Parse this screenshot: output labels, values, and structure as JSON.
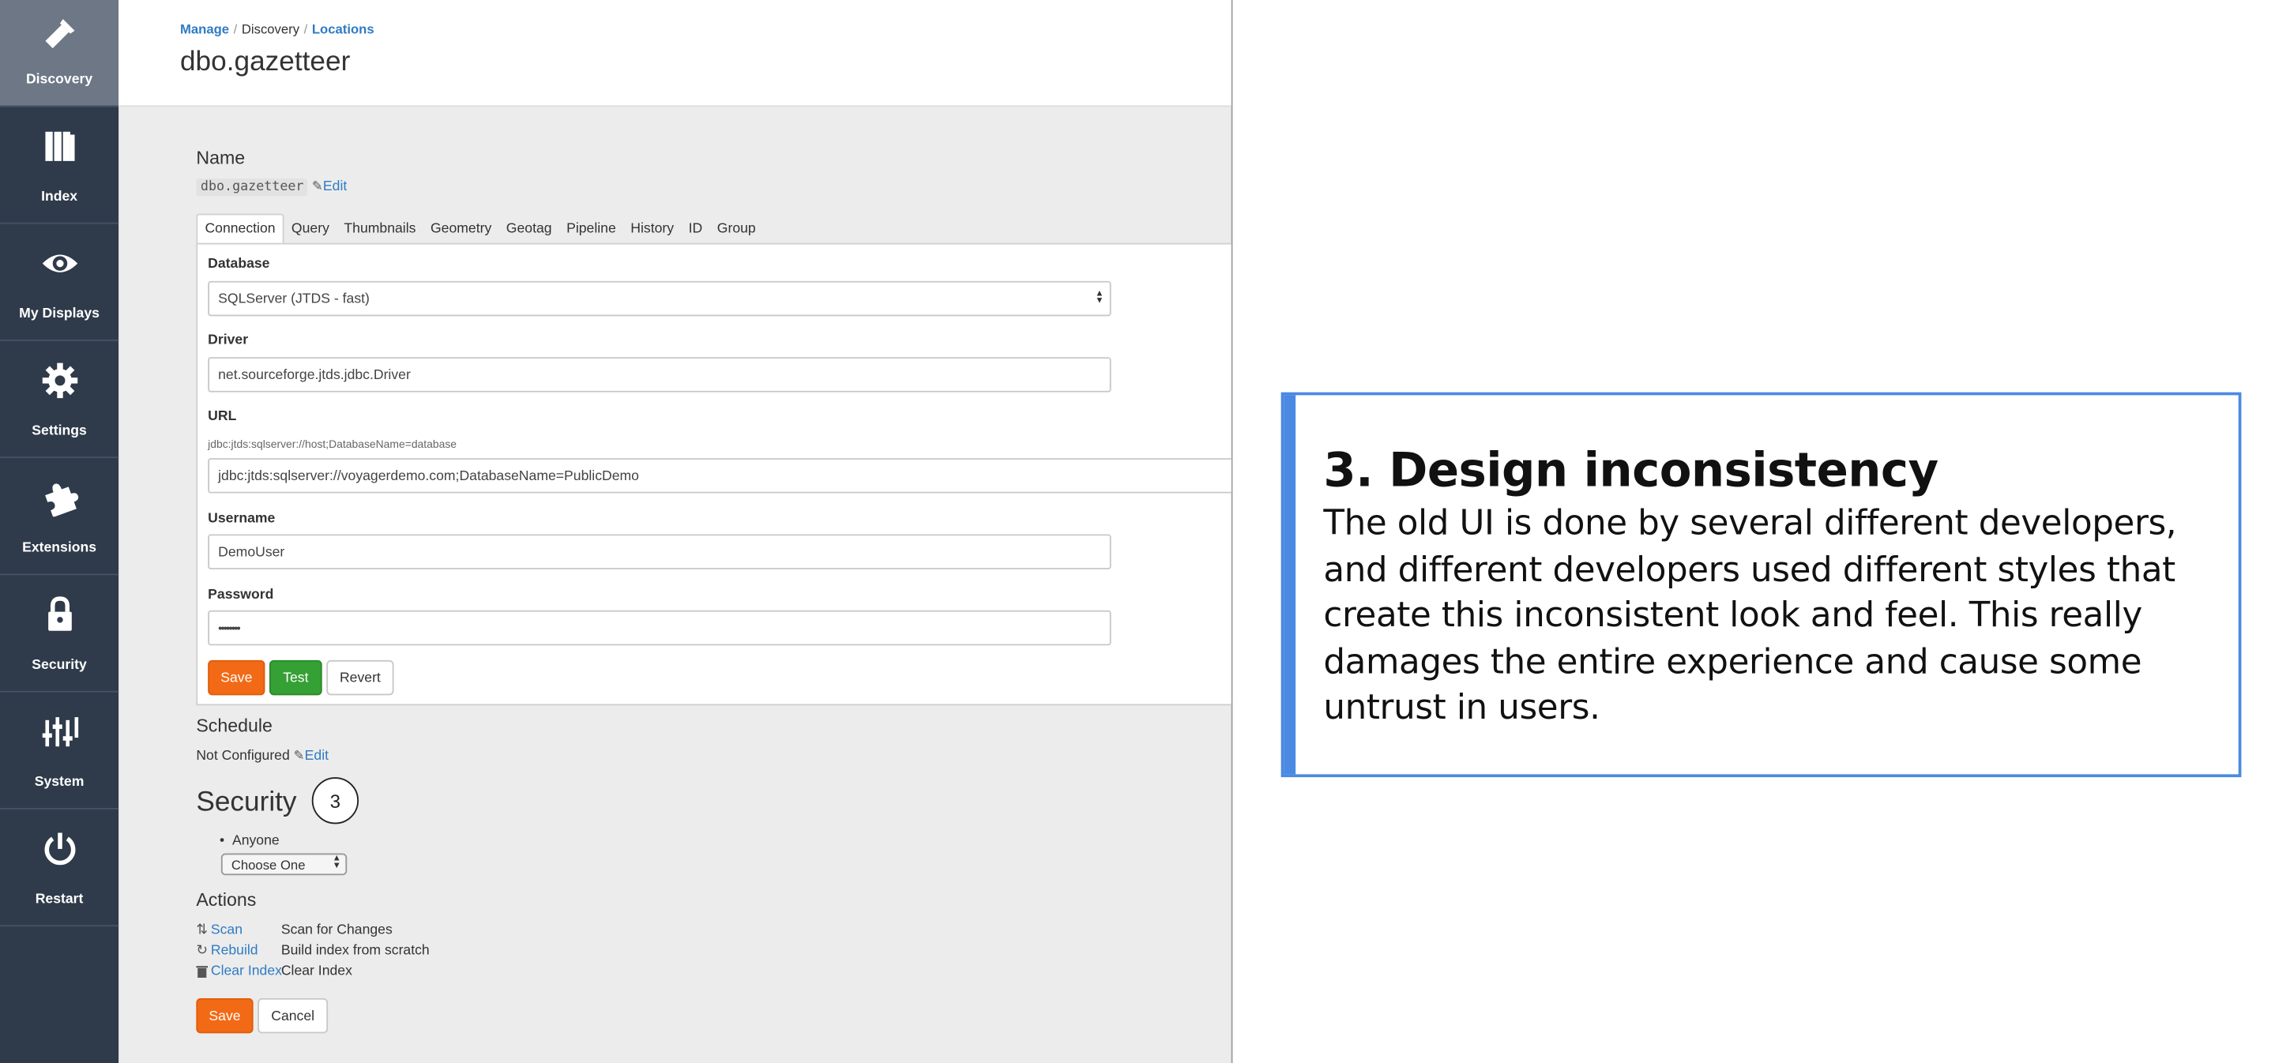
{
  "sidebar": {
    "items": [
      {
        "label": "Discovery",
        "icon": "flashlight-icon"
      },
      {
        "label": "Index",
        "icon": "books-icon"
      },
      {
        "label": "My Displays",
        "icon": "eye-icon"
      },
      {
        "label": "Settings",
        "icon": "gear-icon"
      },
      {
        "label": "Extensions",
        "icon": "puzzle-icon"
      },
      {
        "label": "Security",
        "icon": "lock-icon"
      },
      {
        "label": "System",
        "icon": "sliders-icon"
      },
      {
        "label": "Restart",
        "icon": "power-icon"
      }
    ]
  },
  "breadcrumb": [
    "Manage",
    "Discovery",
    "Locations"
  ],
  "page_title": "dbo.gazetteer",
  "name_section": {
    "label": "Name",
    "value": "dbo.gazetteer",
    "edit": "Edit"
  },
  "tabs": [
    "Connection",
    "Query",
    "Thumbnails",
    "Geometry",
    "Geotag",
    "Pipeline",
    "History",
    "ID",
    "Group"
  ],
  "connection": {
    "database_label": "Database",
    "database_value": "SQLServer (JTDS - fast)",
    "driver_label": "Driver",
    "driver_value": "net.sourceforge.jtds.jdbc.Driver",
    "url_label": "URL",
    "url_hint": "jdbc:jtds:sqlserver://host;DatabaseName=database",
    "url_value": "jdbc:jtds:sqlserver://voyagerdemo.com;DatabaseName=PublicDemo",
    "username_label": "Username",
    "username_value": "DemoUser",
    "password_label": "Password",
    "password_value": "••••••••",
    "save": "Save",
    "test": "Test",
    "revert": "Revert"
  },
  "schedule": {
    "label": "Schedule",
    "value": "Not Configured",
    "edit": "Edit"
  },
  "security": {
    "title": "Security",
    "marker": "3",
    "item": "Anyone",
    "select": "Choose One"
  },
  "actions": {
    "label": "Actions",
    "rows": [
      {
        "link": "Scan",
        "desc": "Scan for Changes"
      },
      {
        "link": "Rebuild",
        "desc": "Build index from scratch"
      },
      {
        "link": "Clear Index",
        "desc": "Clear Index"
      }
    ],
    "save": "Save",
    "cancel": "Cancel"
  },
  "callout": {
    "title": "3. Design inconsistency",
    "body": "The old UI is done by several different developers, and different developers used different styles that create this inconsistent look and feel. This really damages the entire experience and cause some untrust in users."
  },
  "colors": {
    "sidebar": "#2f3a4a",
    "sidebar_active": "#6d7786",
    "link": "#2f7bc4",
    "orange": "#f26a15",
    "green": "#35a033",
    "callout_border": "#4a8ae2"
  }
}
